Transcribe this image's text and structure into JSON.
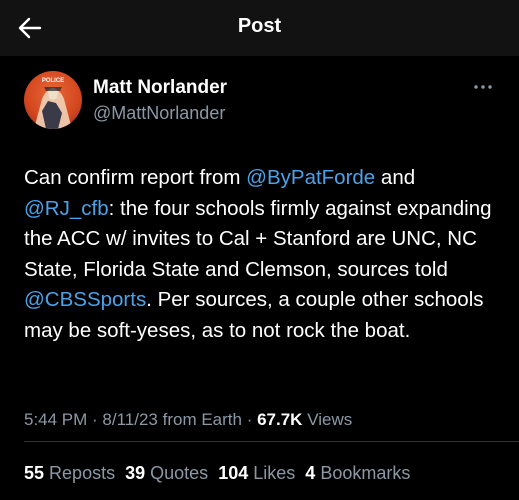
{
  "header": {
    "title": "Post",
    "back_icon": "arrow-left-icon"
  },
  "author": {
    "display_name": "Matt Norlander",
    "handle": "@MattNorlander",
    "avatar_icon": "avatar-image",
    "avatar_text": "POLICE"
  },
  "more_icon": "more-horizontal-icon",
  "tweet": {
    "t1": "Can confirm report from ",
    "m1": "@ByPatForde",
    "t2": " and ",
    "m2": "@RJ_cfb",
    "t3": ": the four schools firmly against expanding the ACC w/ invites to Cal + Stanford are UNC, NC State, Florida State and Clemson, sources told ",
    "m3": "@CBSSports",
    "t4": ". Per sources, a couple other schools may be soft-yeses, as to not rock the boat."
  },
  "meta": {
    "time": "5:44 PM",
    "sep1": " · ",
    "date": "8/11/23",
    "source": " from Earth",
    "sep2": " · ",
    "views_count": "67.7K",
    "views_label": " Views"
  },
  "stats": {
    "reposts_count": "55",
    "reposts_label": "Reposts",
    "quotes_count": "39",
    "quotes_label": "Quotes",
    "likes_count": "104",
    "likes_label": "Likes",
    "bookmarks_count": "4",
    "bookmarks_label": "Bookmarks"
  },
  "colors": {
    "background": "#000000",
    "header_bg": "#121212",
    "text": "#ffffff",
    "secondary": "#8b98a5",
    "link": "#4ca2e8",
    "divider": "#2f3336"
  }
}
